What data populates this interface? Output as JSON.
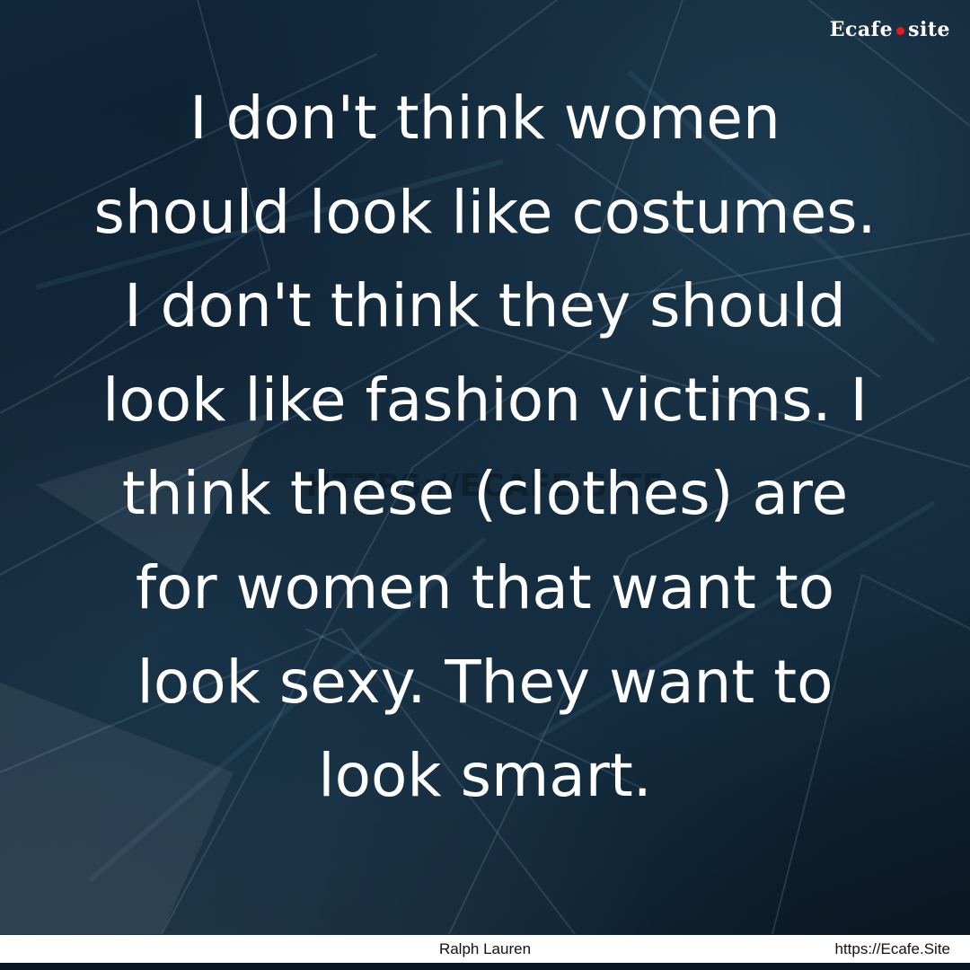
{
  "brand": {
    "prefix": "Ecafe",
    "suffix": "site",
    "dot_color": "#e11b22"
  },
  "watermark": "HTTPS://ECAFE.SITE",
  "quote": {
    "lines": [
      "I don't think women",
      "should look like costumes.",
      "I don't think they should",
      "look like fashion victims. I",
      "think these (clothes) are",
      "for women that want to",
      "look sexy. They want to",
      "look smart."
    ]
  },
  "footer": {
    "author": "Ralph Lauren",
    "site": "https://Ecafe.Site"
  },
  "colors": {
    "background": "#0c1a26",
    "text": "#ffffff",
    "footer_bg": "#ffffff"
  }
}
